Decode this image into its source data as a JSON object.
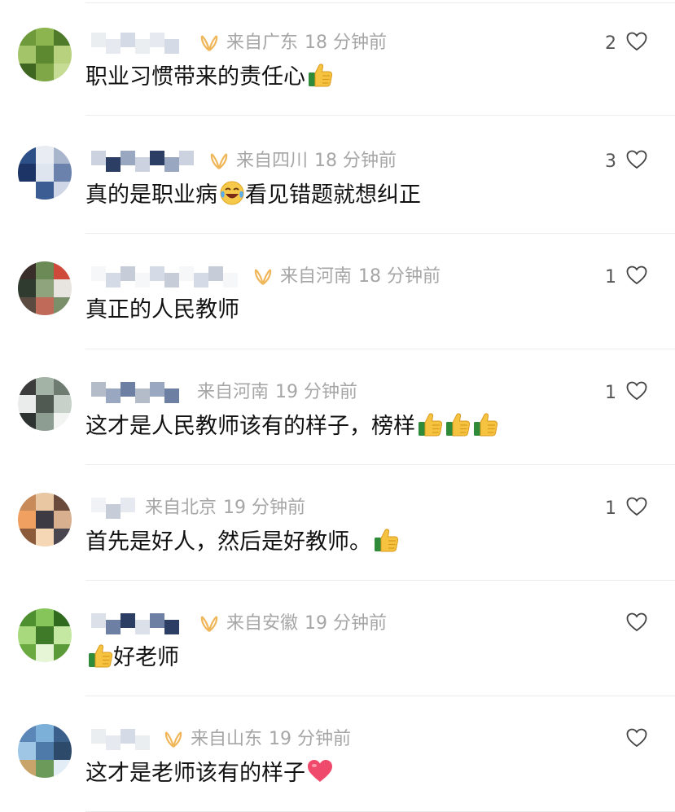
{
  "comments": [
    {
      "location": "来自广东",
      "time": "18 分钟前",
      "text": "职业习惯带来的责任心",
      "emoji": "thumbs-up",
      "emoji_count": 1,
      "emoji_pos": "end",
      "likes": "2",
      "badge": true,
      "name_width": 120
    },
    {
      "location": "来自四川",
      "time": "18 分钟前",
      "text": "真的是职业病",
      "text2": "看见错题就想纠正",
      "emoji": "laughing-crying",
      "emoji_count": 1,
      "emoji_pos": "middle",
      "likes": "3",
      "badge": true,
      "name_width": 132
    },
    {
      "location": "来自河南",
      "time": "18 分钟前",
      "text": "真正的人民教师",
      "emoji": "none",
      "emoji_count": 0,
      "emoji_pos": "end",
      "likes": "1",
      "badge": true,
      "name_width": 186
    },
    {
      "location": "来自河南",
      "time": "19 分钟前",
      "text": "这才是人民教师该有的样子，榜样",
      "emoji": "thumbs-up",
      "emoji_count": 3,
      "emoji_pos": "end",
      "likes": "1",
      "badge": false,
      "name_width": 118
    },
    {
      "location": "来自北京",
      "time": "19 分钟前",
      "text": "首先是好人，然后是好教师。",
      "emoji": "thumbs-up",
      "emoji_count": 1,
      "emoji_pos": "end",
      "likes": "1",
      "badge": false,
      "name_width": 54
    },
    {
      "location": "来自安徽",
      "time": "19 分钟前",
      "text": "好老师",
      "emoji": "thumbs-up",
      "emoji_count": 1,
      "emoji_pos": "start",
      "likes": "",
      "badge": true,
      "name_width": 120
    },
    {
      "location": "来自山东",
      "time": "19 分钟前",
      "text": "这才是老师该有的样子",
      "emoji": "heart",
      "emoji_count": 1,
      "emoji_pos": "end",
      "likes": "",
      "badge": true,
      "name_width": 76
    }
  ],
  "colors": {
    "meta": "#a6a6a6",
    "text": "#111111",
    "badge": "#f0b65a",
    "divider": "#ececec"
  }
}
